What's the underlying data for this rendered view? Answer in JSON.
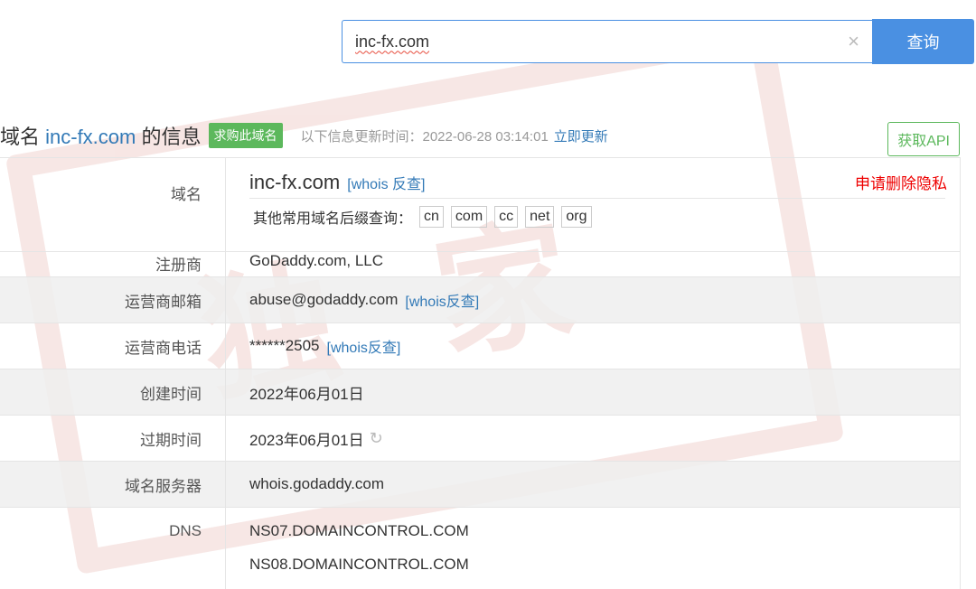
{
  "search": {
    "value": "inc-fx.com",
    "clear_icon": "×",
    "button": "查询"
  },
  "header": {
    "title_prefix": "域名 ",
    "domain": "inc-fx.com",
    "title_suffix": " 的信息",
    "buy_badge": "求购此域名",
    "update_label": "以下信息更新时间：2022-06-28 03:14:01",
    "update_link": "立即更新",
    "api_button": "获取API"
  },
  "rows": {
    "domain": {
      "label": "域名",
      "value": "inc-fx.com",
      "reverse_link": "[whois 反查]",
      "privacy_link": "申请删除隐私",
      "suffix_label": "其他常用域名后缀查询：",
      "suffixes": [
        "cn",
        "com",
        "cc",
        "net",
        "org"
      ]
    },
    "registrar": {
      "label": "注册商",
      "value": "GoDaddy.com, LLC"
    },
    "email": {
      "label": "运营商邮箱",
      "value": "abuse@godaddy.com",
      "reverse_link": "[whois反查]"
    },
    "phone": {
      "label": "运营商电话",
      "value": "******2505",
      "reverse_link": "[whois反查]"
    },
    "created": {
      "label": "创建时间",
      "value": "2022年06月01日"
    },
    "expires": {
      "label": "过期时间",
      "value": "2023年06月01日",
      "refresh_icon": "refresh-icon"
    },
    "whois_server": {
      "label": "域名服务器",
      "value": "whois.godaddy.com"
    },
    "dns": {
      "label": "DNS",
      "values": [
        "NS07.DOMAINCONTROL.COM",
        "NS08.DOMAINCONTROL.COM"
      ]
    }
  },
  "colors": {
    "accent": "#4a90e2",
    "link": "#337ab7",
    "success": "#5cb85c",
    "danger": "#ee0000"
  }
}
